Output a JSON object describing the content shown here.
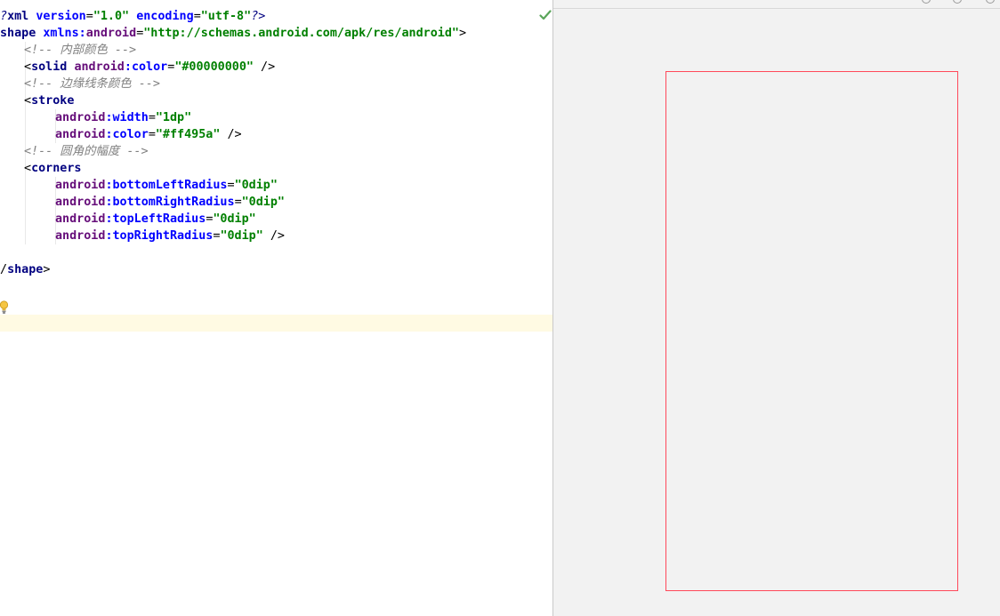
{
  "editor": {
    "file_type": "xml",
    "lines": {
      "l1": {
        "p1": "?",
        "p2": "xml",
        "p3": " ",
        "p4": "version",
        "p5": "=",
        "p6": "\"1.0\"",
        "p7": " ",
        "p8": "encoding",
        "p9": "=",
        "p10": "\"utf-8\"",
        "p11": "?>"
      },
      "l2": {
        "p1": "shape",
        "p2": " ",
        "p3": "xmlns:",
        "p4": "android",
        "p5": "=",
        "p6": "\"http://schemas.android.com/apk/res/android\"",
        "p7": ">"
      },
      "l3": {
        "p1": "<!-- 内部颜色 -->"
      },
      "l4": {
        "p1": "<",
        "p2": "solid",
        "p3": " ",
        "p4": "android",
        "p5": ":",
        "p6": "color",
        "p7": "=",
        "p8": "\"#00000000\"",
        "p9": " />"
      },
      "l5": {
        "p1": "<!-- 边缘线条颜色 -->"
      },
      "l6": {
        "p1": "<",
        "p2": "stroke"
      },
      "l7": {
        "p1": "android",
        "p2": ":",
        "p3": "width",
        "p4": "=",
        "p5": "\"1dp\""
      },
      "l8": {
        "p1": "android",
        "p2": ":",
        "p3": "color",
        "p4": "=",
        "p5": "\"#ff495a\"",
        "p6": " />"
      },
      "l9": {
        "p1": "<!-- 圆角的幅度 -->"
      },
      "l10": {
        "p1": "<",
        "p2": "corners"
      },
      "l11": {
        "p1": "android",
        "p2": ":",
        "p3": "bottomLeftRadius",
        "p4": "=",
        "p5": "\"0dip\""
      },
      "l12": {
        "p1": "android",
        "p2": ":",
        "p3": "bottomRightRadius",
        "p4": "=",
        "p5": "\"0dip\""
      },
      "l13": {
        "p1": "android",
        "p2": ":",
        "p3": "topLeftRadius",
        "p4": "=",
        "p5": "\"0dip\""
      },
      "l14": {
        "p1": "android",
        "p2": ":",
        "p3": "topRightRadius",
        "p4": "=",
        "p5": "\"0dip\"",
        "p6": " />"
      },
      "l15": {
        "p1": "/",
        "p2": "shape",
        "p3": ">"
      }
    }
  },
  "icons": {
    "status": "check-icon",
    "intention": "lightbulb-icon"
  },
  "preview": {
    "shape": {
      "fill_color": "#00000000",
      "stroke_color": "#ff495a",
      "stroke_width": "1dp"
    }
  },
  "colors": {
    "tag": "#000080",
    "attribute": "#660e7a",
    "value": "#008000",
    "comment": "#808080",
    "check": "#5aa55a"
  }
}
